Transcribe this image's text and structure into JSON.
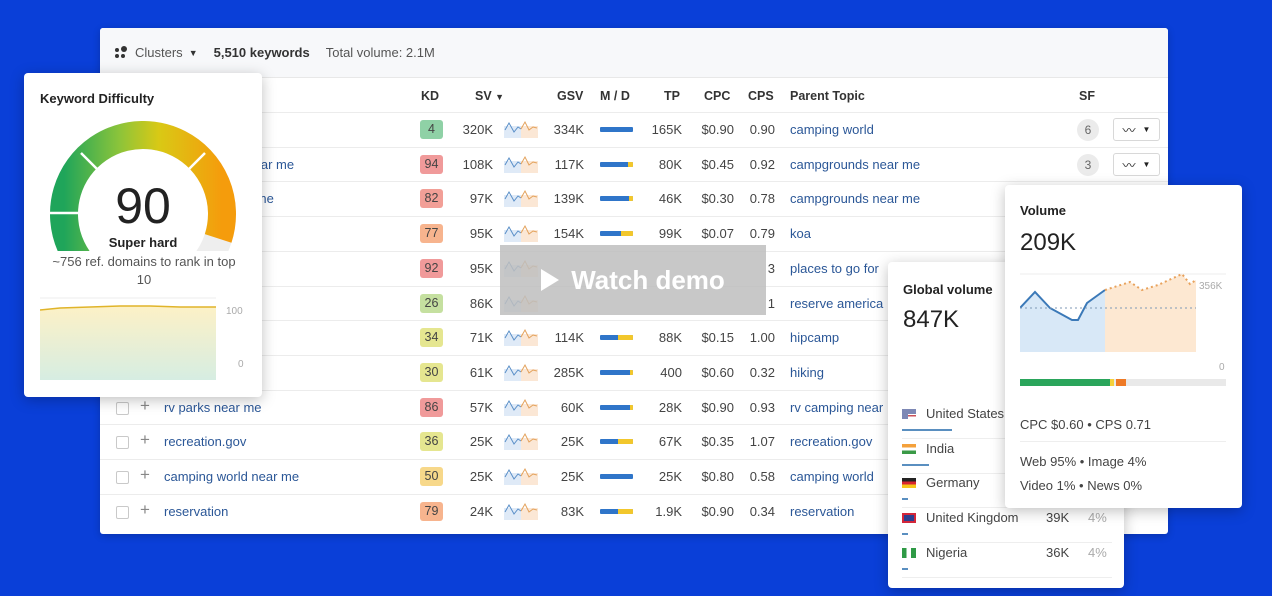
{
  "toolbar": {
    "clusters_label": "Clusters",
    "keywords_count": "5,510 keywords",
    "total_volume": "Total volume: 2.1M"
  },
  "columns": {
    "kd": "KD",
    "sv": "SV",
    "gsv": "GSV",
    "md": "M / D",
    "tp": "TP",
    "cpc": "CPC",
    "cps": "CPS",
    "parent_topic": "Parent Topic",
    "sf": "SF"
  },
  "rows": [
    {
      "keyword": "",
      "kd": "4",
      "kd_color": "#8fd1a6",
      "sv": "320K",
      "gsv": "334K",
      "md_yellow": 0,
      "tp": "165K",
      "cpc": "$0.90",
      "cps": "0.90",
      "parent": "camping world",
      "sf": "6"
    },
    {
      "keyword": "campgrounds near me",
      "kd": "94",
      "kd_color": "#f09a9a",
      "sv": "108K",
      "gsv": "117K",
      "md_yellow": 0.15,
      "tp": "80K",
      "cpc": "$0.45",
      "cps": "0.92",
      "parent": "campgrounds near me",
      "sf": "3"
    },
    {
      "keyword": "campsites near me",
      "kd": "82",
      "kd_color": "#f29f97",
      "sv": "97K",
      "gsv": "139K",
      "md_yellow": 0.12,
      "tp": "46K",
      "cpc": "$0.30",
      "cps": "0.78",
      "parent": "campgrounds near me",
      "sf": ""
    },
    {
      "keyword": "koa",
      "kd": "77",
      "kd_color": "#f7b48e",
      "sv": "95K",
      "gsv": "154K",
      "md_yellow": 0.35,
      "tp": "99K",
      "cpc": "$0.07",
      "cps": "0.79",
      "parent": "koa",
      "sf": ""
    },
    {
      "keyword": "",
      "kd": "92",
      "kd_color": "#f09a9a",
      "sv": "95K",
      "gsv": "",
      "md_yellow": 0,
      "tp": "",
      "cpc": "",
      "cps": "3",
      "parent": "places to go for",
      "sf": ""
    },
    {
      "keyword": "",
      "kd": "26",
      "kd_color": "#c5e0a0",
      "sv": "86K",
      "gsv": "",
      "md_yellow": 0,
      "tp": "",
      "cpc": "",
      "cps": "1",
      "parent": "reserve america",
      "sf": ""
    },
    {
      "keyword": "hipcamp",
      "kd": "34",
      "kd_color": "#e5e690",
      "sv": "71K",
      "gsv": "114K",
      "md_yellow": 0.45,
      "tp": "88K",
      "cpc": "$0.15",
      "cps": "1.00",
      "parent": "hipcamp",
      "sf": ""
    },
    {
      "keyword": "hiking",
      "kd": "30",
      "kd_color": "#e5e690",
      "sv": "61K",
      "gsv": "285K",
      "md_yellow": 0.08,
      "tp": "400",
      "cpc": "$0.60",
      "cps": "0.32",
      "parent": "hiking",
      "sf": ""
    },
    {
      "keyword": "rv parks near me",
      "kd": "86",
      "kd_color": "#f09a9a",
      "sv": "57K",
      "gsv": "60K",
      "md_yellow": 0.1,
      "tp": "28K",
      "cpc": "$0.90",
      "cps": "0.93",
      "parent": "rv camping near",
      "sf": ""
    },
    {
      "keyword": "recreation.gov",
      "kd": "36",
      "kd_color": "#e5e690",
      "sv": "25K",
      "gsv": "25K",
      "md_yellow": 0.45,
      "tp": "67K",
      "cpc": "$0.35",
      "cps": "1.07",
      "parent": "recreation.gov",
      "sf": ""
    },
    {
      "keyword": "camping world near me",
      "kd": "50",
      "kd_color": "#f7d88a",
      "sv": "25K",
      "gsv": "25K",
      "md_yellow": 0,
      "tp": "25K",
      "cpc": "$0.80",
      "cps": "0.58",
      "parent": "camping world",
      "sf": ""
    },
    {
      "keyword": "reservation",
      "kd": "79",
      "kd_color": "#f7b48e",
      "sv": "24K",
      "gsv": "83K",
      "md_yellow": 0.45,
      "tp": "1.9K",
      "cpc": "$0.90",
      "cps": "0.34",
      "parent": "reservation",
      "sf": ""
    }
  ],
  "demo": {
    "label": "Watch demo"
  },
  "kd_card": {
    "title": "Keyword Difficulty",
    "value": "90",
    "level": "Super hard",
    "description": "~756 ref. domains to rank in top 10",
    "axis_max": "100",
    "axis_min": "0",
    "score_fraction": 0.9
  },
  "global_volume": {
    "title": "Global volume",
    "value": "847K",
    "countries": [
      {
        "name": "United States",
        "volume": "",
        "pct": "",
        "share": 0.55
      },
      {
        "name": "India",
        "volume": "",
        "pct": "",
        "share": 0.3
      },
      {
        "name": "Germany",
        "volume": "",
        "pct": "",
        "share": 0
      },
      {
        "name": "United Kingdom",
        "volume": "39K",
        "pct": "4%",
        "share": 0.03
      },
      {
        "name": "Nigeria",
        "volume": "36K",
        "pct": "4%",
        "share": 0.03
      }
    ]
  },
  "volume_card": {
    "title": "Volume",
    "value": "209K",
    "axis_max": "356K",
    "axis_min": "0",
    "cpc_cps": "CPC $0.60 • CPS 0.71",
    "serp_line1": "Web 95% • Image 4%",
    "serp_line2": "Video 1% • News 0%"
  }
}
